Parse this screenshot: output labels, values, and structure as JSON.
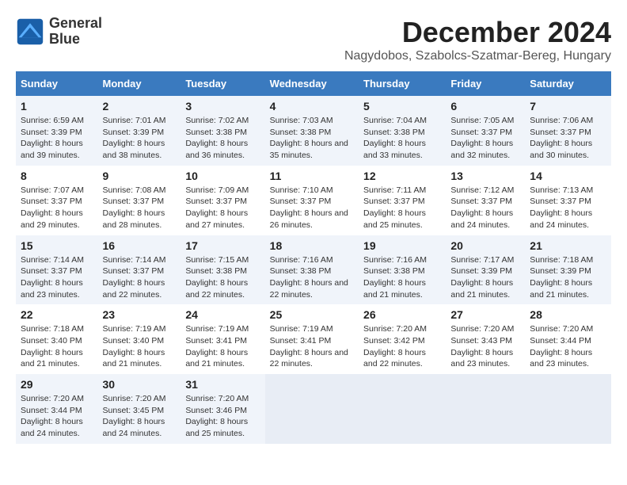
{
  "logo": {
    "line1": "General",
    "line2": "Blue"
  },
  "title": "December 2024",
  "subtitle": "Nagydobos, Szabolcs-Szatmar-Bereg, Hungary",
  "days_header": [
    "Sunday",
    "Monday",
    "Tuesday",
    "Wednesday",
    "Thursday",
    "Friday",
    "Saturday"
  ],
  "weeks": [
    [
      {
        "num": "1",
        "rise": "6:59 AM",
        "set": "3:39 PM",
        "daylight": "8 hours and 39 minutes."
      },
      {
        "num": "2",
        "rise": "7:01 AM",
        "set": "3:39 PM",
        "daylight": "8 hours and 38 minutes."
      },
      {
        "num": "3",
        "rise": "7:02 AM",
        "set": "3:38 PM",
        "daylight": "8 hours and 36 minutes."
      },
      {
        "num": "4",
        "rise": "7:03 AM",
        "set": "3:38 PM",
        "daylight": "8 hours and 35 minutes."
      },
      {
        "num": "5",
        "rise": "7:04 AM",
        "set": "3:38 PM",
        "daylight": "8 hours and 33 minutes."
      },
      {
        "num": "6",
        "rise": "7:05 AM",
        "set": "3:37 PM",
        "daylight": "8 hours and 32 minutes."
      },
      {
        "num": "7",
        "rise": "7:06 AM",
        "set": "3:37 PM",
        "daylight": "8 hours and 30 minutes."
      }
    ],
    [
      {
        "num": "8",
        "rise": "7:07 AM",
        "set": "3:37 PM",
        "daylight": "8 hours and 29 minutes."
      },
      {
        "num": "9",
        "rise": "7:08 AM",
        "set": "3:37 PM",
        "daylight": "8 hours and 28 minutes."
      },
      {
        "num": "10",
        "rise": "7:09 AM",
        "set": "3:37 PM",
        "daylight": "8 hours and 27 minutes."
      },
      {
        "num": "11",
        "rise": "7:10 AM",
        "set": "3:37 PM",
        "daylight": "8 hours and 26 minutes."
      },
      {
        "num": "12",
        "rise": "7:11 AM",
        "set": "3:37 PM",
        "daylight": "8 hours and 25 minutes."
      },
      {
        "num": "13",
        "rise": "7:12 AM",
        "set": "3:37 PM",
        "daylight": "8 hours and 24 minutes."
      },
      {
        "num": "14",
        "rise": "7:13 AM",
        "set": "3:37 PM",
        "daylight": "8 hours and 24 minutes."
      }
    ],
    [
      {
        "num": "15",
        "rise": "7:14 AM",
        "set": "3:37 PM",
        "daylight": "8 hours and 23 minutes."
      },
      {
        "num": "16",
        "rise": "7:14 AM",
        "set": "3:37 PM",
        "daylight": "8 hours and 22 minutes."
      },
      {
        "num": "17",
        "rise": "7:15 AM",
        "set": "3:38 PM",
        "daylight": "8 hours and 22 minutes."
      },
      {
        "num": "18",
        "rise": "7:16 AM",
        "set": "3:38 PM",
        "daylight": "8 hours and 22 minutes."
      },
      {
        "num": "19",
        "rise": "7:16 AM",
        "set": "3:38 PM",
        "daylight": "8 hours and 21 minutes."
      },
      {
        "num": "20",
        "rise": "7:17 AM",
        "set": "3:39 PM",
        "daylight": "8 hours and 21 minutes."
      },
      {
        "num": "21",
        "rise": "7:18 AM",
        "set": "3:39 PM",
        "daylight": "8 hours and 21 minutes."
      }
    ],
    [
      {
        "num": "22",
        "rise": "7:18 AM",
        "set": "3:40 PM",
        "daylight": "8 hours and 21 minutes."
      },
      {
        "num": "23",
        "rise": "7:19 AM",
        "set": "3:40 PM",
        "daylight": "8 hours and 21 minutes."
      },
      {
        "num": "24",
        "rise": "7:19 AM",
        "set": "3:41 PM",
        "daylight": "8 hours and 21 minutes."
      },
      {
        "num": "25",
        "rise": "7:19 AM",
        "set": "3:41 PM",
        "daylight": "8 hours and 22 minutes."
      },
      {
        "num": "26",
        "rise": "7:20 AM",
        "set": "3:42 PM",
        "daylight": "8 hours and 22 minutes."
      },
      {
        "num": "27",
        "rise": "7:20 AM",
        "set": "3:43 PM",
        "daylight": "8 hours and 23 minutes."
      },
      {
        "num": "28",
        "rise": "7:20 AM",
        "set": "3:44 PM",
        "daylight": "8 hours and 23 minutes."
      }
    ],
    [
      {
        "num": "29",
        "rise": "7:20 AM",
        "set": "3:44 PM",
        "daylight": "8 hours and 24 minutes."
      },
      {
        "num": "30",
        "rise": "7:20 AM",
        "set": "3:45 PM",
        "daylight": "8 hours and 24 minutes."
      },
      {
        "num": "31",
        "rise": "7:20 AM",
        "set": "3:46 PM",
        "daylight": "8 hours and 25 minutes."
      },
      null,
      null,
      null,
      null
    ]
  ]
}
